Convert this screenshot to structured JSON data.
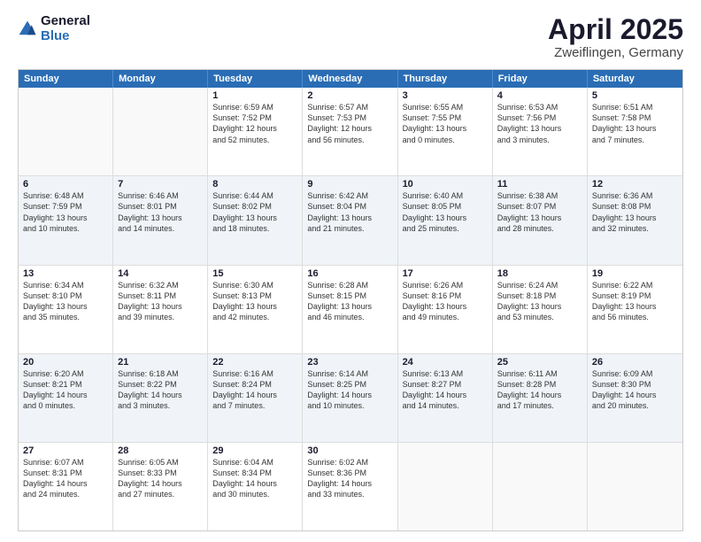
{
  "header": {
    "logo_general": "General",
    "logo_blue": "Blue",
    "title": "April 2025",
    "location": "Zweiflingen, Germany"
  },
  "calendar": {
    "days": [
      "Sunday",
      "Monday",
      "Tuesday",
      "Wednesday",
      "Thursday",
      "Friday",
      "Saturday"
    ],
    "rows": [
      [
        {
          "day": "",
          "lines": [],
          "empty": true
        },
        {
          "day": "",
          "lines": [],
          "empty": true
        },
        {
          "day": "1",
          "lines": [
            "Sunrise: 6:59 AM",
            "Sunset: 7:52 PM",
            "Daylight: 12 hours",
            "and 52 minutes."
          ]
        },
        {
          "day": "2",
          "lines": [
            "Sunrise: 6:57 AM",
            "Sunset: 7:53 PM",
            "Daylight: 12 hours",
            "and 56 minutes."
          ]
        },
        {
          "day": "3",
          "lines": [
            "Sunrise: 6:55 AM",
            "Sunset: 7:55 PM",
            "Daylight: 13 hours",
            "and 0 minutes."
          ]
        },
        {
          "day": "4",
          "lines": [
            "Sunrise: 6:53 AM",
            "Sunset: 7:56 PM",
            "Daylight: 13 hours",
            "and 3 minutes."
          ]
        },
        {
          "day": "5",
          "lines": [
            "Sunrise: 6:51 AM",
            "Sunset: 7:58 PM",
            "Daylight: 13 hours",
            "and 7 minutes."
          ]
        }
      ],
      [
        {
          "day": "6",
          "lines": [
            "Sunrise: 6:48 AM",
            "Sunset: 7:59 PM",
            "Daylight: 13 hours",
            "and 10 minutes."
          ]
        },
        {
          "day": "7",
          "lines": [
            "Sunrise: 6:46 AM",
            "Sunset: 8:01 PM",
            "Daylight: 13 hours",
            "and 14 minutes."
          ]
        },
        {
          "day": "8",
          "lines": [
            "Sunrise: 6:44 AM",
            "Sunset: 8:02 PM",
            "Daylight: 13 hours",
            "and 18 minutes."
          ]
        },
        {
          "day": "9",
          "lines": [
            "Sunrise: 6:42 AM",
            "Sunset: 8:04 PM",
            "Daylight: 13 hours",
            "and 21 minutes."
          ]
        },
        {
          "day": "10",
          "lines": [
            "Sunrise: 6:40 AM",
            "Sunset: 8:05 PM",
            "Daylight: 13 hours",
            "and 25 minutes."
          ]
        },
        {
          "day": "11",
          "lines": [
            "Sunrise: 6:38 AM",
            "Sunset: 8:07 PM",
            "Daylight: 13 hours",
            "and 28 minutes."
          ]
        },
        {
          "day": "12",
          "lines": [
            "Sunrise: 6:36 AM",
            "Sunset: 8:08 PM",
            "Daylight: 13 hours",
            "and 32 minutes."
          ]
        }
      ],
      [
        {
          "day": "13",
          "lines": [
            "Sunrise: 6:34 AM",
            "Sunset: 8:10 PM",
            "Daylight: 13 hours",
            "and 35 minutes."
          ]
        },
        {
          "day": "14",
          "lines": [
            "Sunrise: 6:32 AM",
            "Sunset: 8:11 PM",
            "Daylight: 13 hours",
            "and 39 minutes."
          ]
        },
        {
          "day": "15",
          "lines": [
            "Sunrise: 6:30 AM",
            "Sunset: 8:13 PM",
            "Daylight: 13 hours",
            "and 42 minutes."
          ]
        },
        {
          "day": "16",
          "lines": [
            "Sunrise: 6:28 AM",
            "Sunset: 8:15 PM",
            "Daylight: 13 hours",
            "and 46 minutes."
          ]
        },
        {
          "day": "17",
          "lines": [
            "Sunrise: 6:26 AM",
            "Sunset: 8:16 PM",
            "Daylight: 13 hours",
            "and 49 minutes."
          ]
        },
        {
          "day": "18",
          "lines": [
            "Sunrise: 6:24 AM",
            "Sunset: 8:18 PM",
            "Daylight: 13 hours",
            "and 53 minutes."
          ]
        },
        {
          "day": "19",
          "lines": [
            "Sunrise: 6:22 AM",
            "Sunset: 8:19 PM",
            "Daylight: 13 hours",
            "and 56 minutes."
          ]
        }
      ],
      [
        {
          "day": "20",
          "lines": [
            "Sunrise: 6:20 AM",
            "Sunset: 8:21 PM",
            "Daylight: 14 hours",
            "and 0 minutes."
          ]
        },
        {
          "day": "21",
          "lines": [
            "Sunrise: 6:18 AM",
            "Sunset: 8:22 PM",
            "Daylight: 14 hours",
            "and 3 minutes."
          ]
        },
        {
          "day": "22",
          "lines": [
            "Sunrise: 6:16 AM",
            "Sunset: 8:24 PM",
            "Daylight: 14 hours",
            "and 7 minutes."
          ]
        },
        {
          "day": "23",
          "lines": [
            "Sunrise: 6:14 AM",
            "Sunset: 8:25 PM",
            "Daylight: 14 hours",
            "and 10 minutes."
          ]
        },
        {
          "day": "24",
          "lines": [
            "Sunrise: 6:13 AM",
            "Sunset: 8:27 PM",
            "Daylight: 14 hours",
            "and 14 minutes."
          ]
        },
        {
          "day": "25",
          "lines": [
            "Sunrise: 6:11 AM",
            "Sunset: 8:28 PM",
            "Daylight: 14 hours",
            "and 17 minutes."
          ]
        },
        {
          "day": "26",
          "lines": [
            "Sunrise: 6:09 AM",
            "Sunset: 8:30 PM",
            "Daylight: 14 hours",
            "and 20 minutes."
          ]
        }
      ],
      [
        {
          "day": "27",
          "lines": [
            "Sunrise: 6:07 AM",
            "Sunset: 8:31 PM",
            "Daylight: 14 hours",
            "and 24 minutes."
          ]
        },
        {
          "day": "28",
          "lines": [
            "Sunrise: 6:05 AM",
            "Sunset: 8:33 PM",
            "Daylight: 14 hours",
            "and 27 minutes."
          ]
        },
        {
          "day": "29",
          "lines": [
            "Sunrise: 6:04 AM",
            "Sunset: 8:34 PM",
            "Daylight: 14 hours",
            "and 30 minutes."
          ]
        },
        {
          "day": "30",
          "lines": [
            "Sunrise: 6:02 AM",
            "Sunset: 8:36 PM",
            "Daylight: 14 hours",
            "and 33 minutes."
          ]
        },
        {
          "day": "",
          "lines": [],
          "empty": true
        },
        {
          "day": "",
          "lines": [],
          "empty": true
        },
        {
          "day": "",
          "lines": [],
          "empty": true
        }
      ]
    ]
  }
}
